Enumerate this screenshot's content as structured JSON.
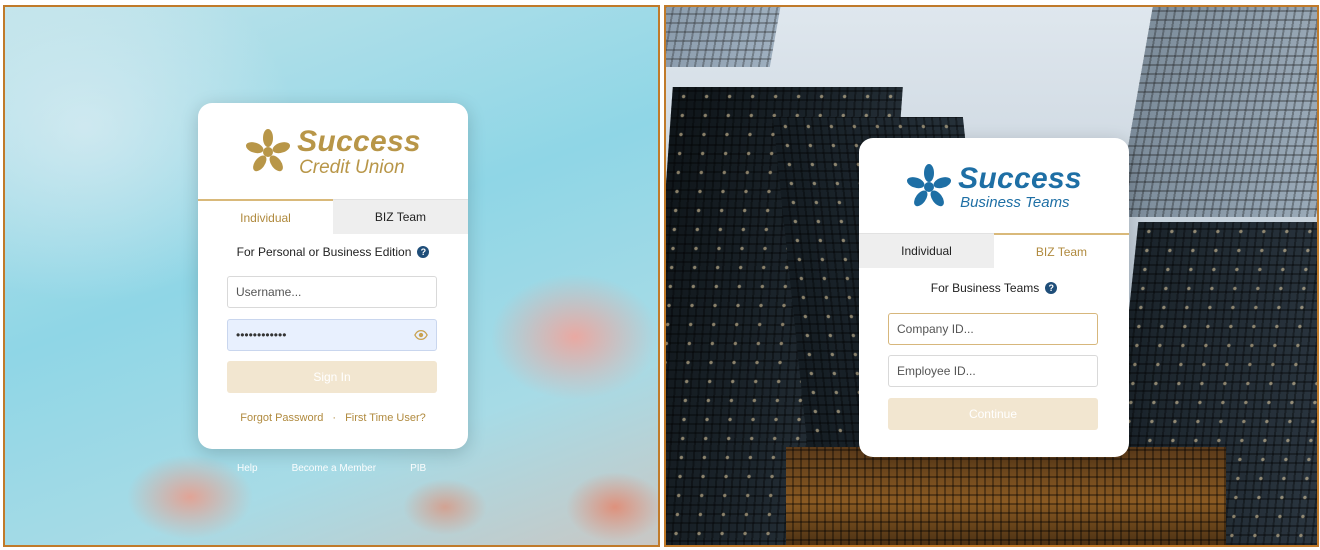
{
  "left_screen": {
    "logo": {
      "main": "Success",
      "sub": "Credit Union"
    },
    "tabs": [
      {
        "label": "Individual",
        "active": true
      },
      {
        "label": "BIZ Team",
        "active": false
      }
    ],
    "edition_label": "For Personal or Business Edition",
    "username_placeholder": "Username...",
    "password_value": "••••••••••••",
    "signin_label": "Sign In",
    "forgot_password": "Forgot Password",
    "separator": "·",
    "first_time_user": "First Time User?",
    "footer": {
      "help": "Help",
      "become_member": "Become a Member",
      "pib": "PIB"
    }
  },
  "right_screen": {
    "logo": {
      "main": "Success",
      "sub": "Business Teams"
    },
    "tabs": [
      {
        "label": "Individual",
        "active": false
      },
      {
        "label": "BIZ Team",
        "active": true
      }
    ],
    "edition_label": "For Business Teams",
    "company_placeholder": "Company ID...",
    "employee_placeholder": "Employee ID...",
    "continue_label": "Continue"
  },
  "colors": {
    "gold_accent": "#b08a3e",
    "blue_brand": "#1e6fa5",
    "help_icon": "#1f4e79",
    "disabled_button": "#f2e6d0"
  },
  "icons": {
    "logo_mark": "flower-mark-icon",
    "help": "help-icon",
    "show_password": "eye-icon"
  }
}
